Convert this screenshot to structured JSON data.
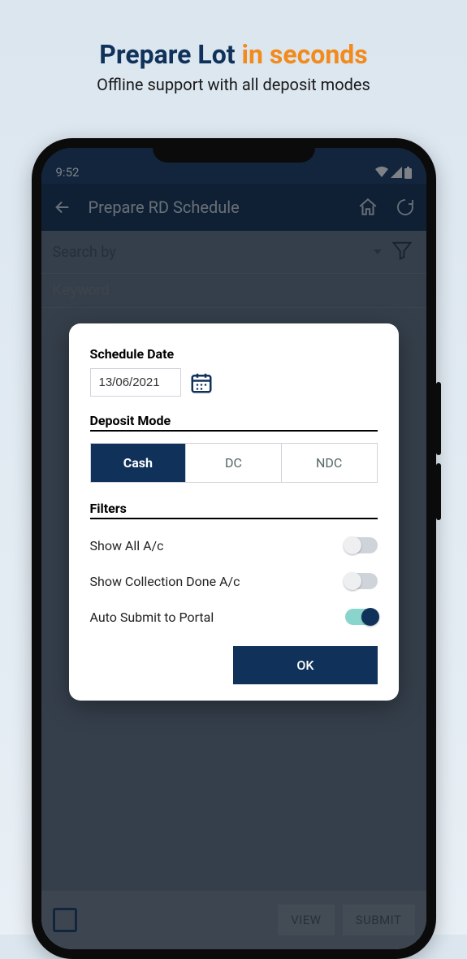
{
  "marketing": {
    "headline_a": "Prepare Lot ",
    "headline_b": "in seconds",
    "subline": "Offline support with all deposit modes"
  },
  "statusbar": {
    "time": "9:52"
  },
  "appbar": {
    "title": "Prepare RD Schedule"
  },
  "search": {
    "by_label": "Search by",
    "keyword_placeholder": "Keyword"
  },
  "dialog": {
    "schedule_label": "Schedule Date",
    "date_value": "13/06/2021",
    "deposit_label": "Deposit Mode",
    "modes": {
      "cash": "Cash",
      "dc": "DC",
      "ndc": "NDC"
    },
    "filters_label": "Filters",
    "filter_rows": {
      "show_all": "Show All A/c",
      "collection_done": "Show Collection Done A/c",
      "auto_submit": "Auto Submit to Portal"
    },
    "ok": "OK"
  },
  "bottom": {
    "view": "VIEW",
    "submit": "SUBMIT"
  }
}
